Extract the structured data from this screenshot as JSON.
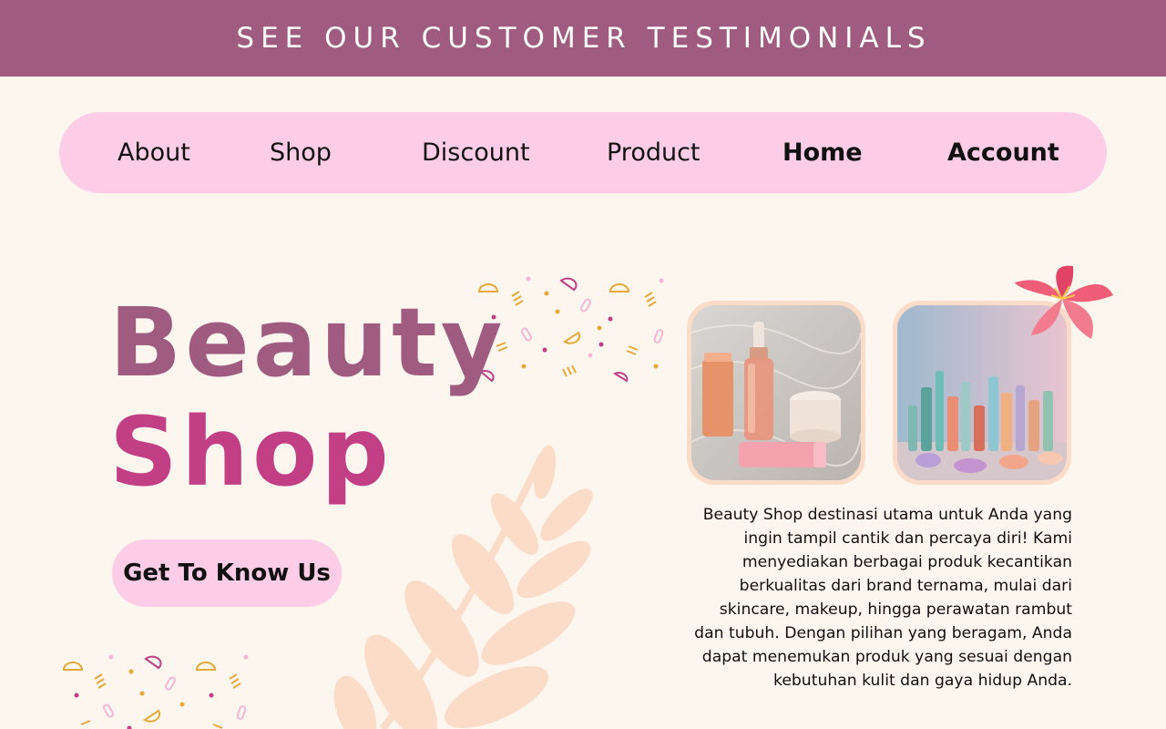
{
  "banner": {
    "title": "SEE OUR CUSTOMER TESTIMONIALS",
    "background": "#a05b80"
  },
  "nav": {
    "items": [
      {
        "label": "About",
        "bold": false
      },
      {
        "label": "Shop",
        "bold": false
      },
      {
        "label": "Discount",
        "bold": false
      },
      {
        "label": "Product",
        "bold": false
      },
      {
        "label": "Home",
        "bold": true
      },
      {
        "label": "Account",
        "bold": true
      }
    ],
    "background": "#fdcde7"
  },
  "hero": {
    "title_line1": "Beauty",
    "title_line2": "Shop",
    "title_line1_color": "#a05b80",
    "title_line2_color": "#c23f86",
    "cta_label": "Get To Know Us"
  },
  "gallery": {
    "photos": [
      {
        "subject": "skincare-bottles-photo"
      },
      {
        "subject": "cosmetics-collection-photo"
      }
    ]
  },
  "description": "Beauty Shop destinasi utama untuk Anda yang ingin tampil cantik dan percaya diri! Kami menyediakan berbagai produk kecantikan berkualitas dari brand ternama, mulai dari skincare, makeup, hingga perawatan rambut dan tubuh. Dengan pilihan yang beragam, Anda dapat menemukan produk yang sesuai dengan kebutuhan kulit dan gaya hidup Anda.",
  "colors": {
    "page_background": "#fdf6ef",
    "accent_pink": "#fdcde7",
    "leaf": "#fbdcc8",
    "flower": "#ef5d78"
  }
}
